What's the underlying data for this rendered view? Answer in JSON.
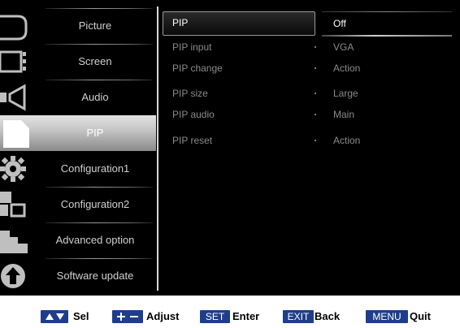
{
  "menu": {
    "items": [
      {
        "label": "Picture",
        "icon": "picture-icon"
      },
      {
        "label": "Screen",
        "icon": "screen-icon"
      },
      {
        "label": "Audio",
        "icon": "speaker-icon"
      },
      {
        "label": "PIP",
        "icon": "pip-icon",
        "selected": true
      },
      {
        "label": "Configuration1",
        "icon": "gear-icon"
      },
      {
        "label": "Configuration2",
        "icon": "configuration2-icon"
      },
      {
        "label": "Advanced option",
        "icon": "advanced-option-icon"
      },
      {
        "label": "Software update",
        "icon": "upload-arrow-icon"
      }
    ]
  },
  "settings": {
    "rows": [
      {
        "label": "PIP",
        "value": "Off"
      },
      {
        "label": "PIP input",
        "value": "VGA"
      },
      {
        "label": "PIP change",
        "value": "Action"
      },
      {
        "label": "PIP size",
        "value": "Large"
      },
      {
        "label": "PIP audio",
        "value": "Main"
      },
      {
        "label": "PIP reset",
        "value": "Action"
      }
    ]
  },
  "help": {
    "sel_label": "Sel",
    "adjust_label": "Adjust",
    "set_key": "SET",
    "enter_label": "Enter",
    "exit_key": "EXIT",
    "back_label": "Back",
    "menu_key": "MENU",
    "quit_label": "Quit"
  },
  "colors": {
    "background": "#000000",
    "selected_item": "#c8c8c8",
    "key_badge": "#1f3e8a"
  }
}
